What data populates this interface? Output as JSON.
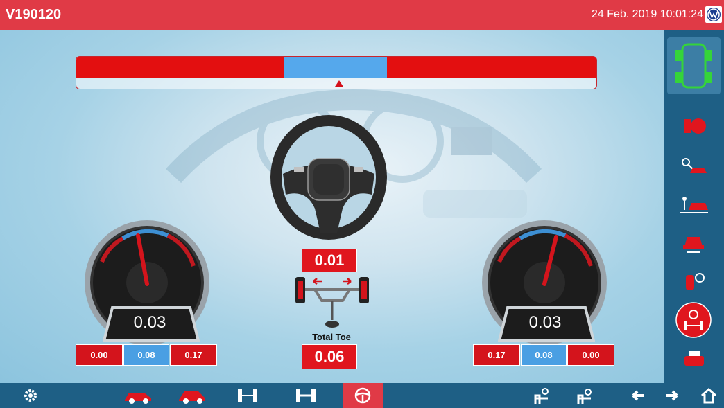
{
  "header": {
    "title": "V190120",
    "datetime": "24 Feb. 2019 10:01:24"
  },
  "center": {
    "steering_value": "0.01",
    "total_toe_label": "Total Toe",
    "total_toe_value": "0.06"
  },
  "left_gauge": {
    "reading": "0.03",
    "min": "0.00",
    "target": "0.08",
    "max": "0.17"
  },
  "right_gauge": {
    "reading": "0.03",
    "min": "0.17",
    "target": "0.08",
    "max": "0.00"
  },
  "colors": {
    "accent_red": "#e03a46",
    "bar_blue": "#55a8ec",
    "nav_blue": "#1e5f85"
  },
  "sidebar": {
    "items": [
      "chassis-icon",
      "wheel-clamp-icon",
      "vehicle-search-icon",
      "lift-car-icon",
      "car-front-icon",
      "wheel-gauge-icon",
      "steering-adjust-icon",
      "printer-icon"
    ]
  },
  "bottom_nav": {
    "items": [
      "gear-icon",
      "car-side-red-icon",
      "car-side-icon",
      "axle-icon",
      "axle-width-icon",
      "steering-wheel-icon",
      "lift-up-icon",
      "lift-icon",
      "arrow-left-icon",
      "arrow-right-icon",
      "home-icon"
    ]
  }
}
